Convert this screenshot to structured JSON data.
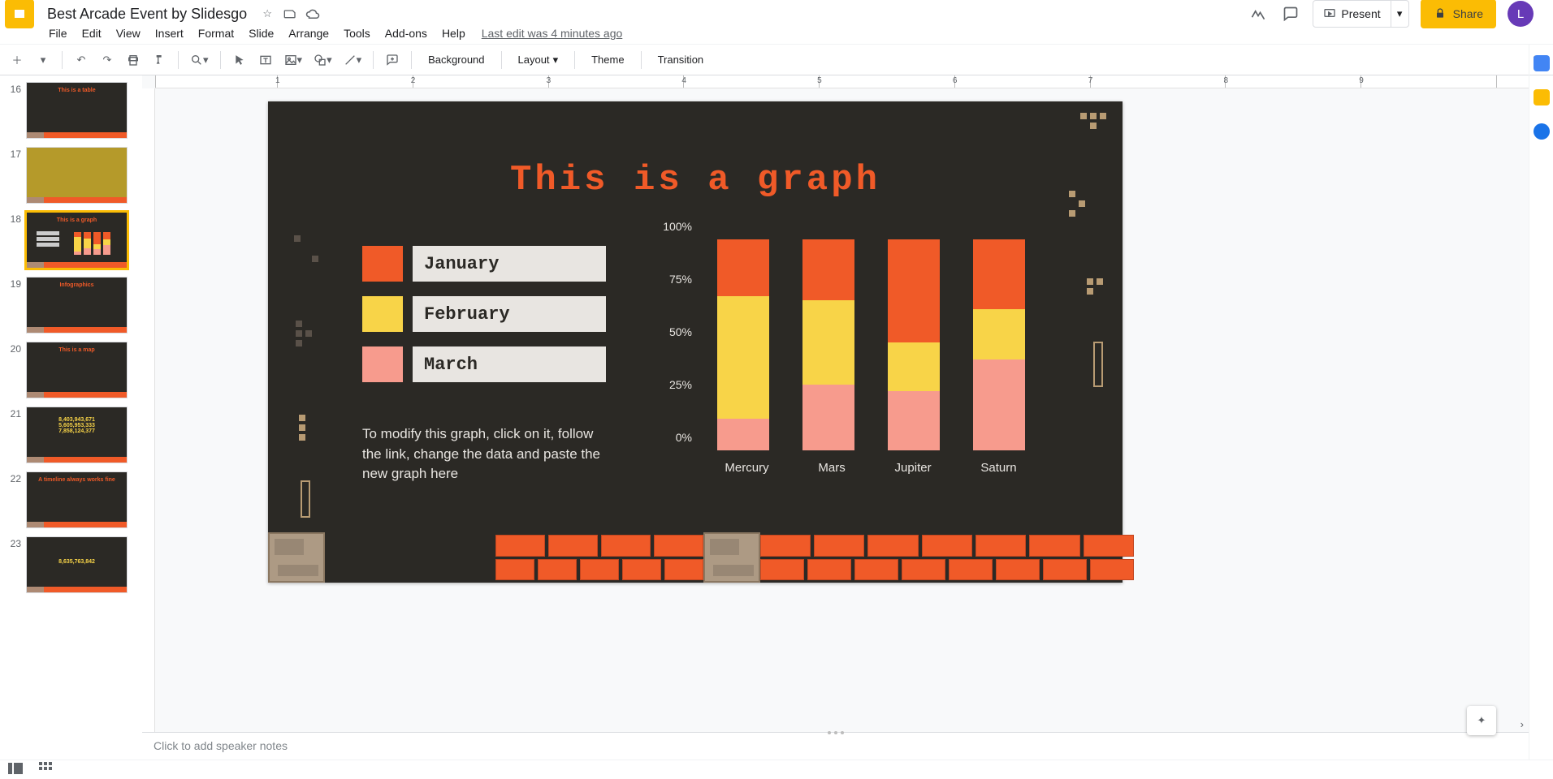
{
  "doc": {
    "title": "Best Arcade Event by Slidesgo",
    "last_edit": "Last edit was 4 minutes ago"
  },
  "menus": [
    "File",
    "Edit",
    "View",
    "Insert",
    "Format",
    "Slide",
    "Arrange",
    "Tools",
    "Add-ons",
    "Help"
  ],
  "header": {
    "present": "Present",
    "share": "Share",
    "avatar_initial": "L"
  },
  "toolbar": {
    "background": "Background",
    "layout": "Layout",
    "theme": "Theme",
    "transition": "Transition"
  },
  "slide": {
    "title": "This is a graph",
    "legend": {
      "jan": "January",
      "feb": "February",
      "mar": "March"
    },
    "body": "To modify this graph, click on it, follow the link, change the data and paste the new graph here"
  },
  "chart_data": {
    "type": "bar-stacked",
    "title": "This is a graph",
    "ylabel": "",
    "ylim": [
      0,
      100
    ],
    "y_ticks": [
      "0%",
      "25%",
      "50%",
      "75%",
      "100%"
    ],
    "categories": [
      "Mercury",
      "Mars",
      "Jupiter",
      "Saturn"
    ],
    "series": [
      {
        "name": "March",
        "color": "#f79b8d",
        "values": [
          15,
          31,
          28,
          43
        ]
      },
      {
        "name": "February",
        "color": "#f8d448",
        "values": [
          58,
          40,
          23,
          24
        ]
      },
      {
        "name": "January",
        "color": "#f05a28",
        "values": [
          27,
          29,
          49,
          33
        ]
      }
    ]
  },
  "filmstrip": {
    "start_index": 16,
    "thumbs": [
      {
        "n": 16,
        "title": "This is a table",
        "title_color": "#f05a28"
      },
      {
        "n": 17,
        "title": "",
        "title_color": "#f8d448"
      },
      {
        "n": 18,
        "title": "This is a graph",
        "title_color": "#f05a28",
        "selected": true
      },
      {
        "n": 19,
        "title": "Infographics",
        "title_color": "#f05a28"
      },
      {
        "n": 20,
        "title": "This is a map",
        "title_color": "#f05a28"
      },
      {
        "n": 21,
        "title": "",
        "title_color": ""
      },
      {
        "n": 22,
        "title": "A timeline always works fine",
        "title_color": "#f05a28"
      },
      {
        "n": 23,
        "title": "",
        "title_color": ""
      }
    ],
    "numbers_21": [
      "8,403,943,671",
      "5,605,953,333",
      "7,858,124,377"
    ],
    "numbers_23": "8,635,763,842"
  },
  "speaker_notes_placeholder": "Click to add speaker notes"
}
